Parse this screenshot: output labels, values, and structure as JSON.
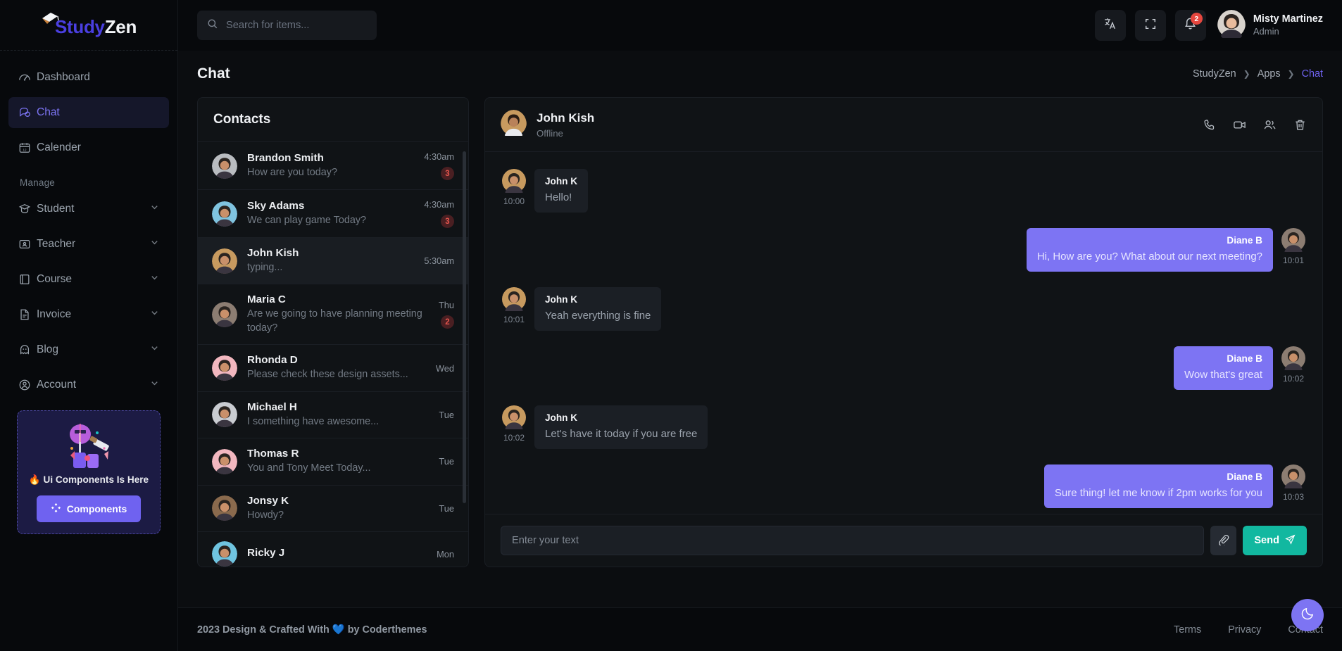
{
  "brand": {
    "part1": "Study",
    "part2": "Zen",
    "icon": "graduation-cap-icon"
  },
  "sidebar": {
    "items": [
      {
        "label": "Dashboard",
        "icon": "speedometer-icon",
        "active": false,
        "caret": false
      },
      {
        "label": "Chat",
        "icon": "chat-bubbles-icon",
        "active": true,
        "caret": false
      },
      {
        "label": "Calender",
        "icon": "calendar-icon",
        "active": false,
        "caret": false
      }
    ],
    "section_title": "Manage",
    "manage_items": [
      {
        "label": "Student",
        "icon": "graduation-hat-icon",
        "caret": true
      },
      {
        "label": "Teacher",
        "icon": "id-card-icon",
        "caret": true
      },
      {
        "label": "Course",
        "icon": "book-icon",
        "caret": true
      },
      {
        "label": "Invoice",
        "icon": "file-text-icon",
        "caret": true
      },
      {
        "label": "Blog",
        "icon": "ghost-icon",
        "caret": true
      },
      {
        "label": "Account",
        "icon": "user-circle-icon",
        "caret": true
      }
    ],
    "promo": {
      "text": "🔥 Ui Components Is Here",
      "button_label": "Components",
      "button_icon": "diamond-cluster-icon",
      "accent": "#6f62f0",
      "bg": "#1c1b44"
    }
  },
  "topbar": {
    "search": {
      "placeholder": "Search for items...",
      "value": "",
      "icon": "search-icon"
    },
    "language_icon": "translate-icon",
    "fullscreen_icon": "fullscreen-icon",
    "notifications": {
      "icon": "bell-icon",
      "count": "2",
      "badge_color": "#e5473f"
    },
    "user": {
      "name": "Misty Martinez",
      "role": "Admin",
      "avatar": "avatar-misty"
    }
  },
  "page": {
    "title": "Chat",
    "breadcrumb": [
      {
        "label": "StudyZen",
        "active": false
      },
      {
        "label": "Apps",
        "active": false
      },
      {
        "label": "Chat",
        "active": true
      }
    ]
  },
  "contacts": {
    "title": "Contacts",
    "items": [
      {
        "name": "Brandon Smith",
        "message": "How are you today?",
        "time": "4:30am",
        "badge": "3",
        "active": false,
        "avatar_bg": "#b9bcc0"
      },
      {
        "name": "Sky Adams",
        "message": "We can play game Today?",
        "time": "4:30am",
        "badge": "3",
        "active": false,
        "avatar_bg": "#7fc3df"
      },
      {
        "name": "John Kish",
        "message": "typing...",
        "time": "5:30am",
        "badge": "",
        "active": true,
        "avatar_bg": "#c79a5f"
      },
      {
        "name": "Maria C",
        "message": "Are we going to have planning meeting today?",
        "time": "Thu",
        "badge": "2",
        "active": false,
        "avatar_bg": "#8c7d72"
      },
      {
        "name": "Rhonda D",
        "message": "Please check these design assets...",
        "time": "Wed",
        "badge": "",
        "active": false,
        "avatar_bg": "#f2b7bf"
      },
      {
        "name": "Michael H",
        "message": "I something have awesome...",
        "time": "Tue",
        "badge": "",
        "active": false,
        "avatar_bg": "#c9ccd1"
      },
      {
        "name": "Thomas R",
        "message": "You and Tony Meet Today...",
        "time": "Tue",
        "badge": "",
        "active": false,
        "avatar_bg": "#f2b7bf"
      },
      {
        "name": "Jonsy K",
        "message": "Howdy?",
        "time": "Tue",
        "badge": "",
        "active": false,
        "avatar_bg": "#8a6a4d"
      },
      {
        "name": "Ricky J",
        "message": "",
        "time": "Mon",
        "badge": "",
        "active": false,
        "avatar_bg": "#6fc4e0"
      }
    ]
  },
  "chat": {
    "header": {
      "name": "John Kish",
      "status": "Offline",
      "avatar_bg": "#c79a5f"
    },
    "actions": [
      {
        "name": "call-icon"
      },
      {
        "name": "video-icon"
      },
      {
        "name": "group-icon"
      },
      {
        "name": "trash-icon"
      }
    ],
    "messages": [
      {
        "sender": "John K",
        "text": "Hello!",
        "time": "10:00",
        "direction": "in",
        "avatar_bg": "#c79a5f"
      },
      {
        "sender": "Diane B",
        "text": "Hi, How are you? What about our next meeting?",
        "time": "10:01",
        "direction": "out",
        "avatar_bg": "#8c7d72"
      },
      {
        "sender": "John K",
        "text": "Yeah everything is fine",
        "time": "10:01",
        "direction": "in",
        "avatar_bg": "#c79a5f"
      },
      {
        "sender": "Diane B",
        "text": "Wow that's great",
        "time": "10:02",
        "direction": "out",
        "avatar_bg": "#8c7d72"
      },
      {
        "sender": "John K",
        "text": "Let's have it today if you are free",
        "time": "10:02",
        "direction": "in",
        "avatar_bg": "#c79a5f"
      },
      {
        "sender": "Diane B",
        "text": "Sure thing! let me know if 2pm works for you",
        "time": "10:03",
        "direction": "out",
        "avatar_bg": "#8c7d72"
      }
    ],
    "composer": {
      "placeholder": "Enter your text",
      "value": "",
      "attach_icon": "paperclip-icon",
      "send_label": "Send",
      "send_icon": "send-plane-icon",
      "send_color": "#12b8a0"
    }
  },
  "footer": {
    "copyright": "2023 Design & Crafted With 💙 by Coderthemes",
    "links": [
      "Terms",
      "Privacy",
      "Contact"
    ],
    "theme_toggle_icon": "moon-icon"
  }
}
